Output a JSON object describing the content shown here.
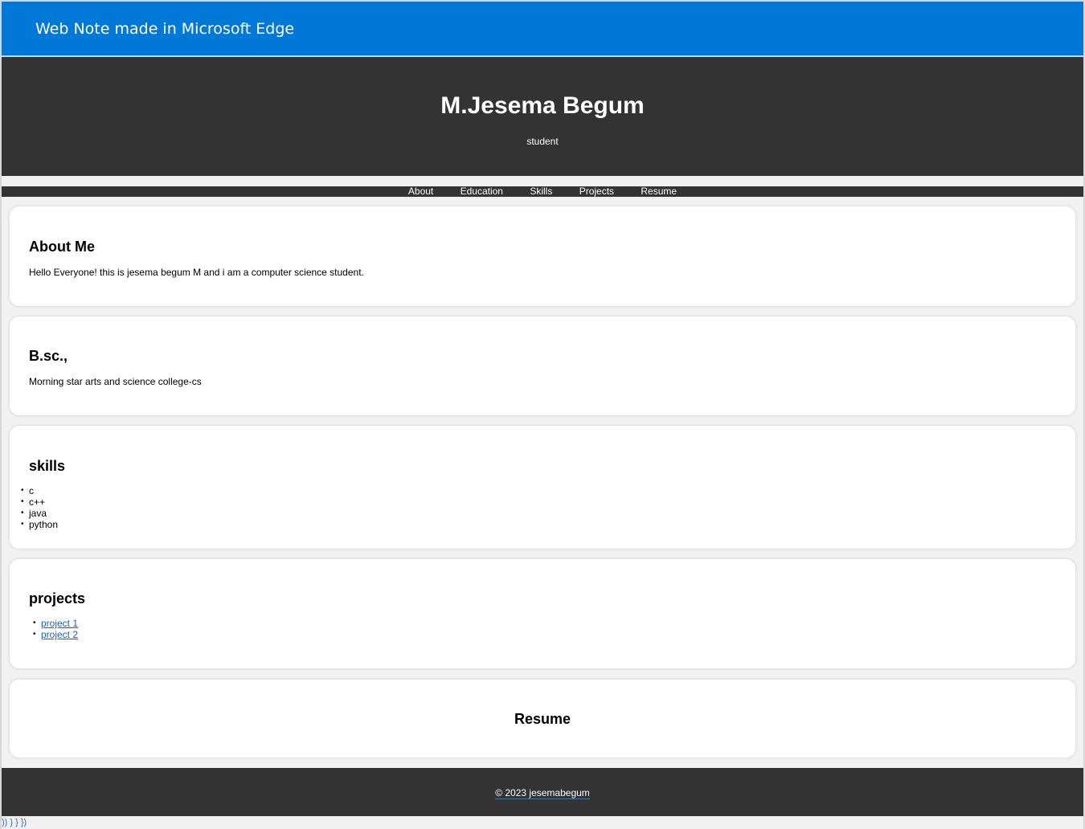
{
  "edge": {
    "title": "Web Note made in Microsoft Edge"
  },
  "hero": {
    "name": "M.Jesema Begum",
    "subtitle": "student"
  },
  "nav": {
    "items": [
      "About",
      "Education",
      "Skills",
      "Projects",
      "Resume"
    ]
  },
  "about": {
    "heading": "About Me",
    "text": "Hello Everyone! this is jesema begum M and i am a computer science student."
  },
  "education": {
    "heading": "B.sc.,",
    "text": "Morning star arts and science college-cs"
  },
  "skills": {
    "heading": "skills",
    "items": [
      "c",
      "c++",
      "java",
      "python"
    ]
  },
  "projects": {
    "heading": "projects",
    "items": [
      "project 1",
      "project 2"
    ]
  },
  "resume": {
    "heading": "Resume"
  },
  "footer": {
    "text": "© 2023 jesemabegum"
  },
  "stray_text": ")) } } })",
  "colors": {
    "edge_blue": "#0078d7",
    "dark": "#333333",
    "link": "#1a5fb4"
  }
}
